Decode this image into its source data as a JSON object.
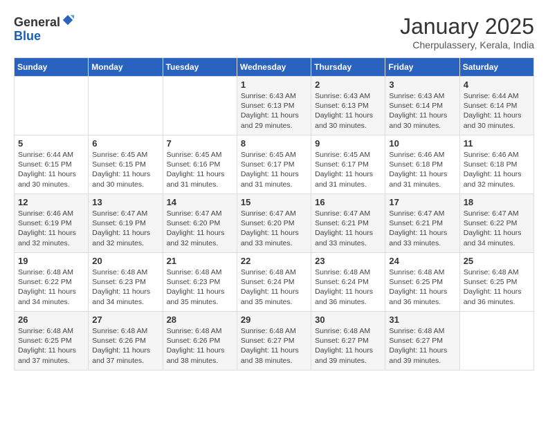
{
  "header": {
    "logo_general": "General",
    "logo_blue": "Blue",
    "month": "January 2025",
    "location": "Cherpulassery, Kerala, India"
  },
  "weekdays": [
    "Sunday",
    "Monday",
    "Tuesday",
    "Wednesday",
    "Thursday",
    "Friday",
    "Saturday"
  ],
  "weeks": [
    [
      {
        "day": "",
        "info": ""
      },
      {
        "day": "",
        "info": ""
      },
      {
        "day": "",
        "info": ""
      },
      {
        "day": "1",
        "info": "Sunrise: 6:43 AM\nSunset: 6:13 PM\nDaylight: 11 hours\nand 29 minutes."
      },
      {
        "day": "2",
        "info": "Sunrise: 6:43 AM\nSunset: 6:13 PM\nDaylight: 11 hours\nand 30 minutes."
      },
      {
        "day": "3",
        "info": "Sunrise: 6:43 AM\nSunset: 6:14 PM\nDaylight: 11 hours\nand 30 minutes."
      },
      {
        "day": "4",
        "info": "Sunrise: 6:44 AM\nSunset: 6:14 PM\nDaylight: 11 hours\nand 30 minutes."
      }
    ],
    [
      {
        "day": "5",
        "info": "Sunrise: 6:44 AM\nSunset: 6:15 PM\nDaylight: 11 hours\nand 30 minutes."
      },
      {
        "day": "6",
        "info": "Sunrise: 6:45 AM\nSunset: 6:15 PM\nDaylight: 11 hours\nand 30 minutes."
      },
      {
        "day": "7",
        "info": "Sunrise: 6:45 AM\nSunset: 6:16 PM\nDaylight: 11 hours\nand 31 minutes."
      },
      {
        "day": "8",
        "info": "Sunrise: 6:45 AM\nSunset: 6:17 PM\nDaylight: 11 hours\nand 31 minutes."
      },
      {
        "day": "9",
        "info": "Sunrise: 6:45 AM\nSunset: 6:17 PM\nDaylight: 11 hours\nand 31 minutes."
      },
      {
        "day": "10",
        "info": "Sunrise: 6:46 AM\nSunset: 6:18 PM\nDaylight: 11 hours\nand 31 minutes."
      },
      {
        "day": "11",
        "info": "Sunrise: 6:46 AM\nSunset: 6:18 PM\nDaylight: 11 hours\nand 32 minutes."
      }
    ],
    [
      {
        "day": "12",
        "info": "Sunrise: 6:46 AM\nSunset: 6:19 PM\nDaylight: 11 hours\nand 32 minutes."
      },
      {
        "day": "13",
        "info": "Sunrise: 6:47 AM\nSunset: 6:19 PM\nDaylight: 11 hours\nand 32 minutes."
      },
      {
        "day": "14",
        "info": "Sunrise: 6:47 AM\nSunset: 6:20 PM\nDaylight: 11 hours\nand 32 minutes."
      },
      {
        "day": "15",
        "info": "Sunrise: 6:47 AM\nSunset: 6:20 PM\nDaylight: 11 hours\nand 33 minutes."
      },
      {
        "day": "16",
        "info": "Sunrise: 6:47 AM\nSunset: 6:21 PM\nDaylight: 11 hours\nand 33 minutes."
      },
      {
        "day": "17",
        "info": "Sunrise: 6:47 AM\nSunset: 6:21 PM\nDaylight: 11 hours\nand 33 minutes."
      },
      {
        "day": "18",
        "info": "Sunrise: 6:47 AM\nSunset: 6:22 PM\nDaylight: 11 hours\nand 34 minutes."
      }
    ],
    [
      {
        "day": "19",
        "info": "Sunrise: 6:48 AM\nSunset: 6:22 PM\nDaylight: 11 hours\nand 34 minutes."
      },
      {
        "day": "20",
        "info": "Sunrise: 6:48 AM\nSunset: 6:23 PM\nDaylight: 11 hours\nand 34 minutes."
      },
      {
        "day": "21",
        "info": "Sunrise: 6:48 AM\nSunset: 6:23 PM\nDaylight: 11 hours\nand 35 minutes."
      },
      {
        "day": "22",
        "info": "Sunrise: 6:48 AM\nSunset: 6:24 PM\nDaylight: 11 hours\nand 35 minutes."
      },
      {
        "day": "23",
        "info": "Sunrise: 6:48 AM\nSunset: 6:24 PM\nDaylight: 11 hours\nand 36 minutes."
      },
      {
        "day": "24",
        "info": "Sunrise: 6:48 AM\nSunset: 6:25 PM\nDaylight: 11 hours\nand 36 minutes."
      },
      {
        "day": "25",
        "info": "Sunrise: 6:48 AM\nSunset: 6:25 PM\nDaylight: 11 hours\nand 36 minutes."
      }
    ],
    [
      {
        "day": "26",
        "info": "Sunrise: 6:48 AM\nSunset: 6:25 PM\nDaylight: 11 hours\nand 37 minutes."
      },
      {
        "day": "27",
        "info": "Sunrise: 6:48 AM\nSunset: 6:26 PM\nDaylight: 11 hours\nand 37 minutes."
      },
      {
        "day": "28",
        "info": "Sunrise: 6:48 AM\nSunset: 6:26 PM\nDaylight: 11 hours\nand 38 minutes."
      },
      {
        "day": "29",
        "info": "Sunrise: 6:48 AM\nSunset: 6:27 PM\nDaylight: 11 hours\nand 38 minutes."
      },
      {
        "day": "30",
        "info": "Sunrise: 6:48 AM\nSunset: 6:27 PM\nDaylight: 11 hours\nand 39 minutes."
      },
      {
        "day": "31",
        "info": "Sunrise: 6:48 AM\nSunset: 6:27 PM\nDaylight: 11 hours\nand 39 minutes."
      },
      {
        "day": "",
        "info": ""
      }
    ]
  ]
}
